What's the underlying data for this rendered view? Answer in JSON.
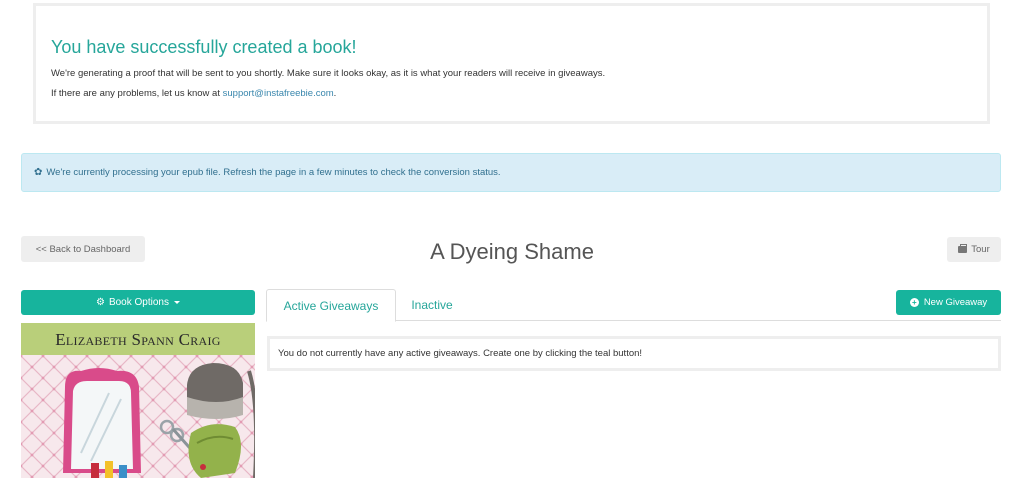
{
  "success": {
    "title": "You have successfully created a book!",
    "line1": "We're generating a proof that will be sent to you shortly. Make sure it looks okay, as it is what your readers will receive in giveaways.",
    "line2_prefix": "If there are any problems, let us know at ",
    "support_email": "support@instafreebie.com",
    "line2_suffix": "."
  },
  "alert": {
    "icon": "gear-icon",
    "text": "We're currently processing your epub file. Refresh the page in a few minutes to check the conversion status."
  },
  "header": {
    "back_label": "<< Back to Dashboard",
    "book_title": "A Dyeing Shame",
    "tour_label": "Tour"
  },
  "book_options": {
    "label": "Book Options",
    "icon": "cogs-icon"
  },
  "tabs": [
    {
      "label": "Active Giveaways",
      "active": true
    },
    {
      "label": "Inactive",
      "active": false
    }
  ],
  "new_giveaway_label": "New Giveaway",
  "empty_message": "You do not currently have any active giveaways. Create one by clicking the teal button!",
  "cover": {
    "author": "Elizabeth Spann Craig"
  },
  "colors": {
    "teal": "#17b49d",
    "link": "#3a87ad",
    "alert_bg": "#d9edf7",
    "cover_band": "#b9cf7a"
  }
}
